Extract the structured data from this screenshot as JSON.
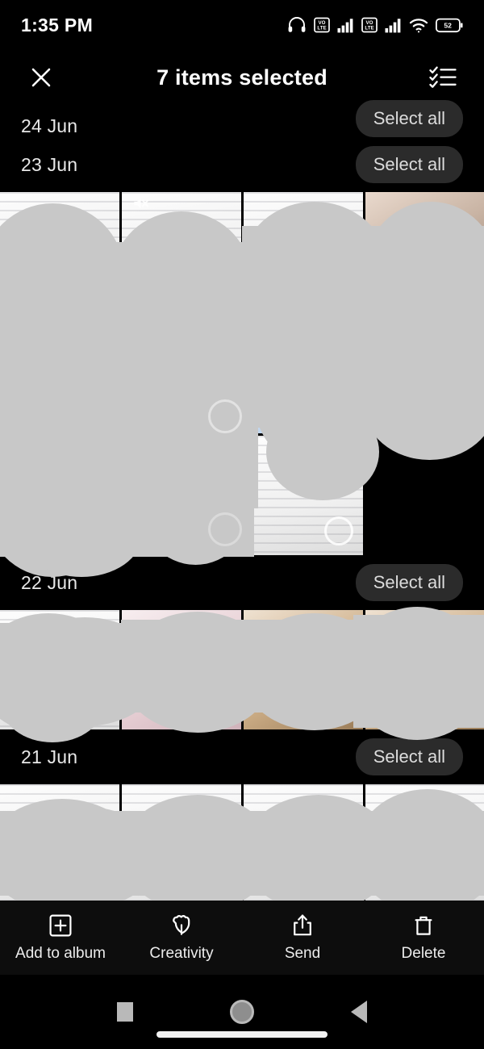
{
  "status_bar": {
    "time": "1:35 PM",
    "battery_percent": "52",
    "icons": [
      "headset-icon",
      "volte-sim1-icon",
      "signal-sim1-icon",
      "volte-sim2-icon",
      "signal-sim2-icon",
      "wifi-icon",
      "battery-icon"
    ]
  },
  "app_bar": {
    "close_label": "close-icon",
    "title": "7 items selected",
    "select_mode_label": "checklist-icon"
  },
  "colors": {
    "background": "#000000",
    "accent_selected": "#1a73e8",
    "pill_background": "#2b2b2b",
    "text_primary": "#ffffff",
    "text_secondary": "#dcdcdc",
    "redaction": "#c8c8c8"
  },
  "select_all_label": "Select all",
  "date_sections": [
    {
      "date": "24 Jun",
      "select_all": "Select all",
      "clipped": true,
      "rows": []
    },
    {
      "date": "23 Jun",
      "select_all": "Select all",
      "clipped": false,
      "rows": [
        [
          {
            "kind": "doc",
            "selected": true,
            "corner_icon": "none"
          },
          {
            "kind": "doc",
            "selected": false,
            "corner_icon": "muted-icon"
          },
          {
            "kind": "doc",
            "selected": true,
            "corner_icon": "none"
          },
          {
            "kind": "photo",
            "selected": true,
            "corner_icon": "none"
          }
        ],
        [
          {
            "kind": "doc",
            "selected": true,
            "corner_icon": "none"
          },
          {
            "kind": "photo",
            "selected": false,
            "corner_icon": "none"
          },
          {
            "kind": "blue",
            "selected": false,
            "corner_icon": "edit-icon"
          },
          {
            "kind": "doc",
            "selected": true,
            "corner_icon": "none"
          }
        ],
        [
          {
            "kind": "photo",
            "selected": false,
            "corner_icon": "none"
          },
          {
            "kind": "doc",
            "selected": false,
            "corner_icon": "none"
          },
          {
            "kind": "doc",
            "selected": false,
            "corner_icon": "none"
          }
        ]
      ]
    },
    {
      "date": "22 Jun",
      "select_all": "Select all",
      "clipped": false,
      "rows": [
        [
          {
            "kind": "doc",
            "selected": false,
            "corner_icon": "none",
            "ring": true
          },
          {
            "kind": "pink",
            "selected": false,
            "corner_icon": "none",
            "ring": true
          },
          {
            "kind": "warm",
            "selected": false,
            "corner_icon": "none",
            "ring": true
          },
          {
            "kind": "warm",
            "selected": false,
            "corner_icon": "none",
            "ring": true
          }
        ]
      ]
    },
    {
      "date": "21 Jun",
      "select_all": "Select all",
      "clipped": false,
      "rows": [
        [
          {
            "kind": "doc",
            "selected": false,
            "corner_icon": "none"
          },
          {
            "kind": "doc",
            "selected": false,
            "corner_icon": "none"
          },
          {
            "kind": "doc",
            "selected": false,
            "corner_icon": "none"
          },
          {
            "kind": "doc",
            "selected": false,
            "corner_icon": "none"
          }
        ]
      ]
    }
  ],
  "bottom_toolbar": [
    {
      "icon": "add-to-album-icon",
      "label": "Add to album"
    },
    {
      "icon": "creativity-flower-icon",
      "label": "Creativity"
    },
    {
      "icon": "send-share-icon",
      "label": "Send"
    },
    {
      "icon": "delete-trash-icon",
      "label": "Delete"
    }
  ],
  "nav_bar": [
    {
      "icon": "recents-square-icon"
    },
    {
      "icon": "home-circle-icon"
    },
    {
      "icon": "back-triangle-icon"
    }
  ]
}
